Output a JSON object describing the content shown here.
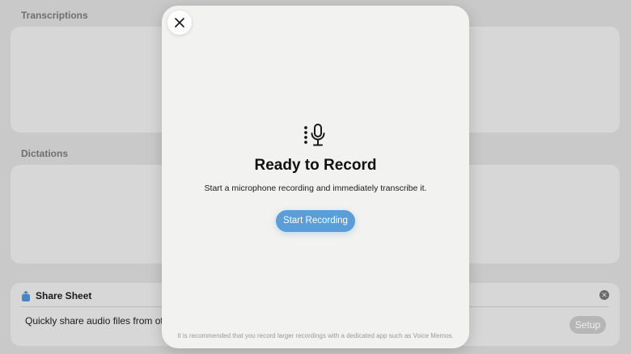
{
  "background": {
    "transcriptions_title": "Transcriptions",
    "dictations_title": "Dictations",
    "share_sheet": {
      "title": "Share Sheet",
      "icon": "share-icon",
      "description": "Quickly share audio files from othe",
      "setup_label": "Setup"
    }
  },
  "modal": {
    "close_icon": "close-icon",
    "mic_icon": "microphone-icon",
    "title": "Ready to Record",
    "subtitle": "Start a microphone recording and immediately transcribe it.",
    "start_button": "Start Recording",
    "footnote": "It is recommended that you record larger recordings with a dedicated app such as Voice Memos."
  },
  "colors": {
    "accent": "#5b9dd6",
    "modal_bg": "#f2f2f0",
    "backdrop": "#c9c9c9"
  }
}
